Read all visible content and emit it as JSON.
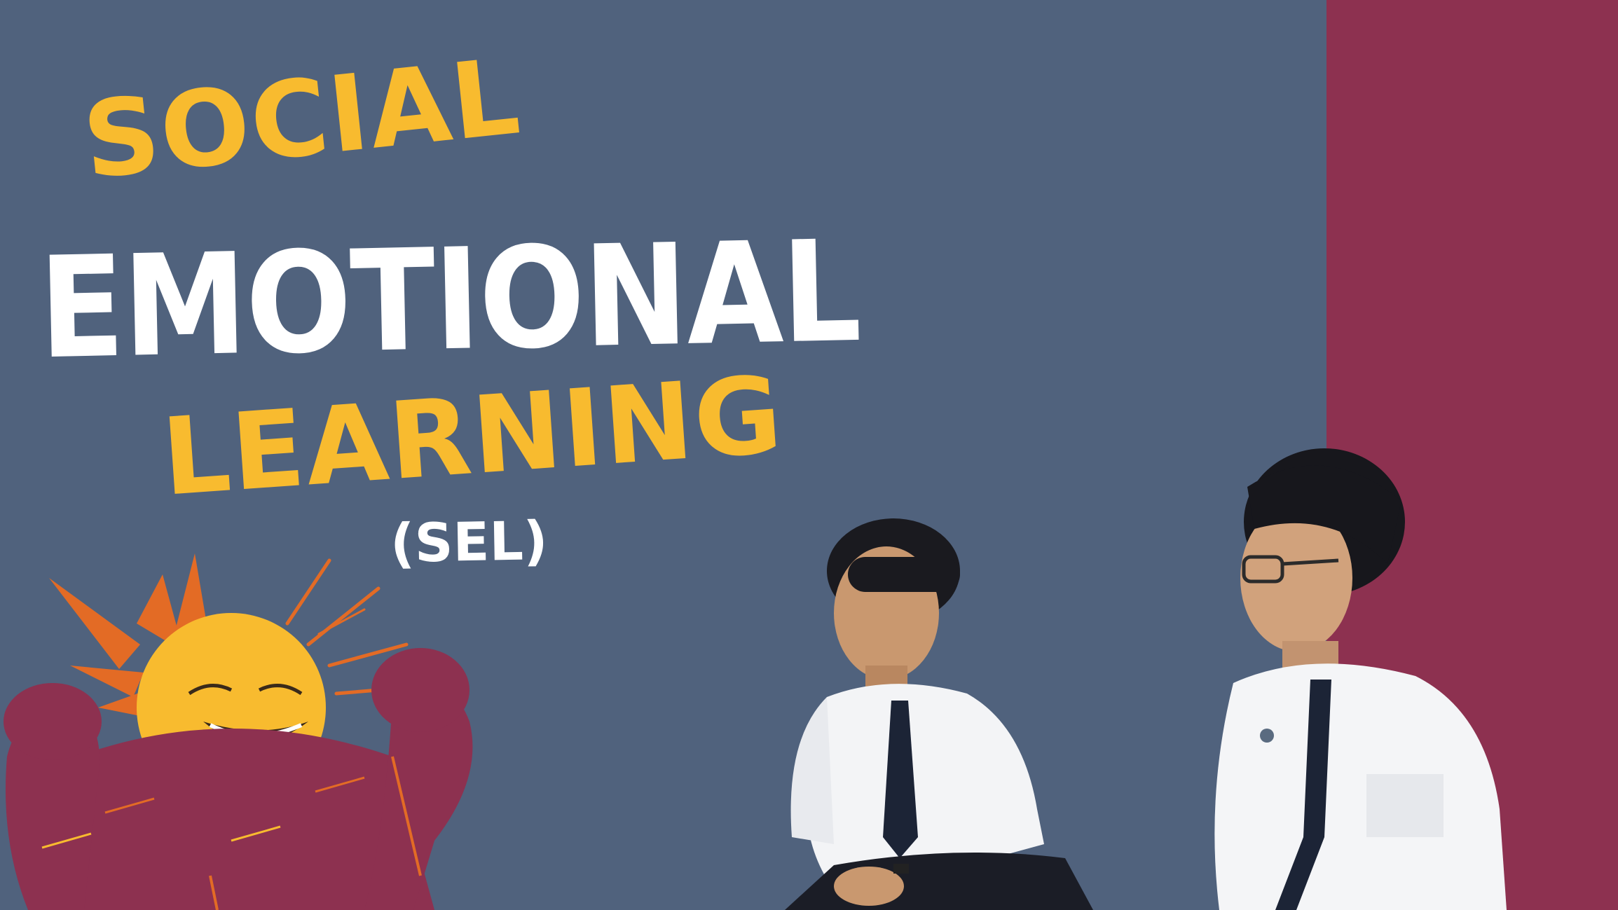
{
  "title": {
    "line1": "SOCIAL",
    "line2": "EMOTIONAL",
    "line3": "LEARNING",
    "abbreviation": "(SEL)"
  },
  "colors": {
    "background": "#50627d",
    "accent_band": "#8d3150",
    "title_yellow": "#f8bb2f",
    "title_white": "#ffffff",
    "mascot_body": "#8d3150",
    "mascot_sun": "#f8bb2f",
    "mascot_rays": "#e36b25"
  },
  "illustration": {
    "icon": "cheering-sun-mascot-icon"
  },
  "photo": {
    "icons": [
      "seated-student-icon",
      "seated-student-with-glasses-icon"
    ]
  }
}
